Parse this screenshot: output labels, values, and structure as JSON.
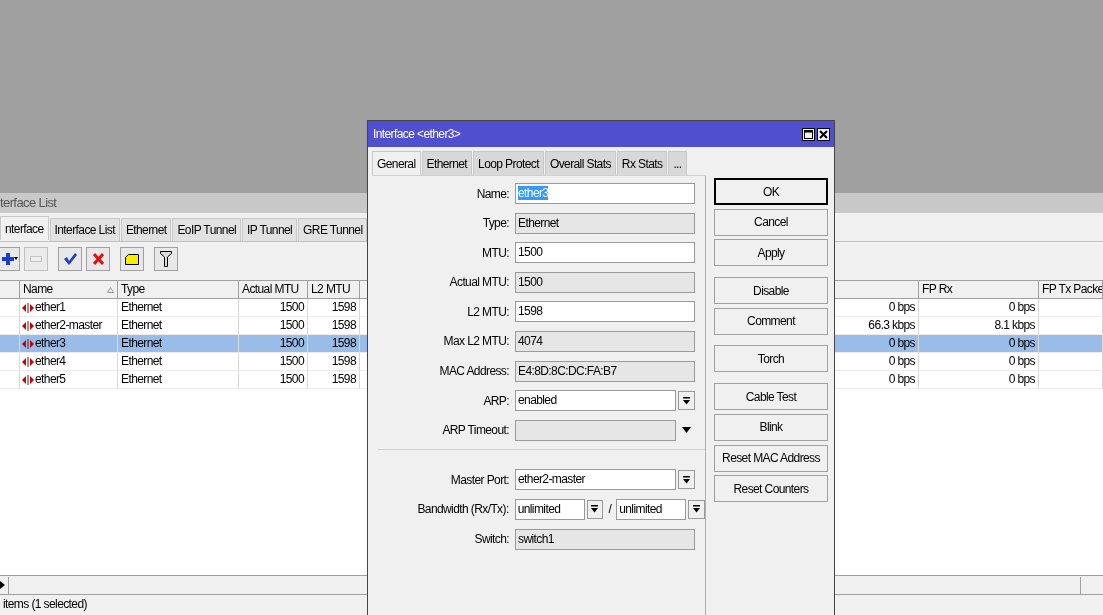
{
  "list_window": {
    "title": "terface List",
    "tabs": [
      {
        "label": "nterface",
        "selected": true
      },
      {
        "label": "Interface List",
        "selected": false
      },
      {
        "label": "Ethernet",
        "selected": false
      },
      {
        "label": "EoIP Tunnel",
        "selected": false
      },
      {
        "label": "IP Tunnel",
        "selected": false
      },
      {
        "label": "GRE Tunnel",
        "selected": false
      }
    ],
    "toolbar": [
      {
        "kind": "add",
        "disabled": false
      },
      {
        "kind": "remove",
        "disabled": true
      },
      {
        "kind": "enable",
        "disabled": false
      },
      {
        "kind": "disable",
        "disabled": false
      },
      {
        "kind": "comment",
        "disabled": false
      },
      {
        "kind": "filter",
        "disabled": false
      }
    ],
    "table": {
      "columns": {
        "name": "Name",
        "type": "Type",
        "actual_mtu": "Actual MTU",
        "l2_mtu": "L2 MTU",
        "fp_rx": "FP Rx",
        "fp_tx_packets": "FP Tx Packe"
      },
      "rows": [
        {
          "name": "ether1",
          "type": "Ethernet",
          "actual_mtu": "1500",
          "l2_mtu": "1598",
          "column_7": "0 bps",
          "fp_rx": "0 bps",
          "selected": false
        },
        {
          "name": "ether2-master",
          "type": "Ethernet",
          "actual_mtu": "1500",
          "l2_mtu": "1598",
          "column_7": "66.3 kbps",
          "fp_rx": "8.1 kbps",
          "selected": false
        },
        {
          "name": "ether3",
          "type": "Ethernet",
          "actual_mtu": "1500",
          "l2_mtu": "1598",
          "column_7": "0 bps",
          "fp_rx": "0 bps",
          "selected": true
        },
        {
          "name": "ether4",
          "type": "Ethernet",
          "actual_mtu": "1500",
          "l2_mtu": "1598",
          "column_7": "0 bps",
          "fp_rx": "0 bps",
          "selected": false
        },
        {
          "name": "ether5",
          "type": "Ethernet",
          "actual_mtu": "1500",
          "l2_mtu": "1598",
          "column_7": "0 bps",
          "fp_rx": "0 bps",
          "selected": false
        }
      ]
    },
    "status_bar": "items (1 selected)"
  },
  "dialog": {
    "title": "Interface <ether3>",
    "tabs": [
      {
        "label": "General",
        "selected": true
      },
      {
        "label": "Ethernet",
        "selected": false
      },
      {
        "label": "Loop Protect",
        "selected": false
      },
      {
        "label": "Overall Stats",
        "selected": false
      },
      {
        "label": "Rx Stats",
        "selected": false
      },
      {
        "label": "...",
        "selected": false
      }
    ],
    "fields": [
      {
        "kind": "text",
        "label": "Name:",
        "value": "ether3",
        "selected": true
      },
      {
        "kind": "readonly",
        "label": "Type:",
        "value": "Ethernet"
      },
      {
        "kind": "text",
        "label": "MTU:",
        "value": "1500",
        "selected": false
      },
      {
        "kind": "readonly",
        "label": "Actual MTU:",
        "value": "1500"
      },
      {
        "kind": "text",
        "label": "L2 MTU:",
        "value": "1598",
        "selected": false
      },
      {
        "kind": "readonly",
        "label": "Max L2 MTU:",
        "value": "4074"
      },
      {
        "kind": "readonly",
        "label": "MAC Address:",
        "value": "E4:8D:8C:DC:FA:B7"
      },
      {
        "kind": "dropdown",
        "label": "ARP:",
        "value": "enabled"
      },
      {
        "kind": "optional",
        "label": "ARP Timeout:"
      },
      {
        "kind": "separator"
      },
      {
        "kind": "dropdown",
        "label": "Master Port:",
        "value": "ether2-master"
      },
      {
        "kind": "pair",
        "label": "Bandwidth (Rx/Tx):",
        "value": "unlimited",
        "separator": "/",
        "value_2": "unlimited"
      },
      {
        "kind": "readonly",
        "label": "Switch:",
        "value": "switch1"
      }
    ],
    "button_groups": [
      [
        {
          "label": "OK",
          "default": true
        },
        {
          "label": "Cancel",
          "default": false
        },
        {
          "label": "Apply",
          "default": false
        }
      ],
      [
        {
          "label": "Disable",
          "default": false
        },
        {
          "label": "Comment",
          "default": false
        }
      ],
      [
        {
          "label": "Torch",
          "default": false
        }
      ],
      [
        {
          "label": "Cable Test",
          "default": false
        },
        {
          "label": "Blink",
          "default": false
        },
        {
          "label": "Reset MAC Address",
          "default": false
        },
        {
          "label": "Reset Counters",
          "default": false
        }
      ]
    ]
  }
}
